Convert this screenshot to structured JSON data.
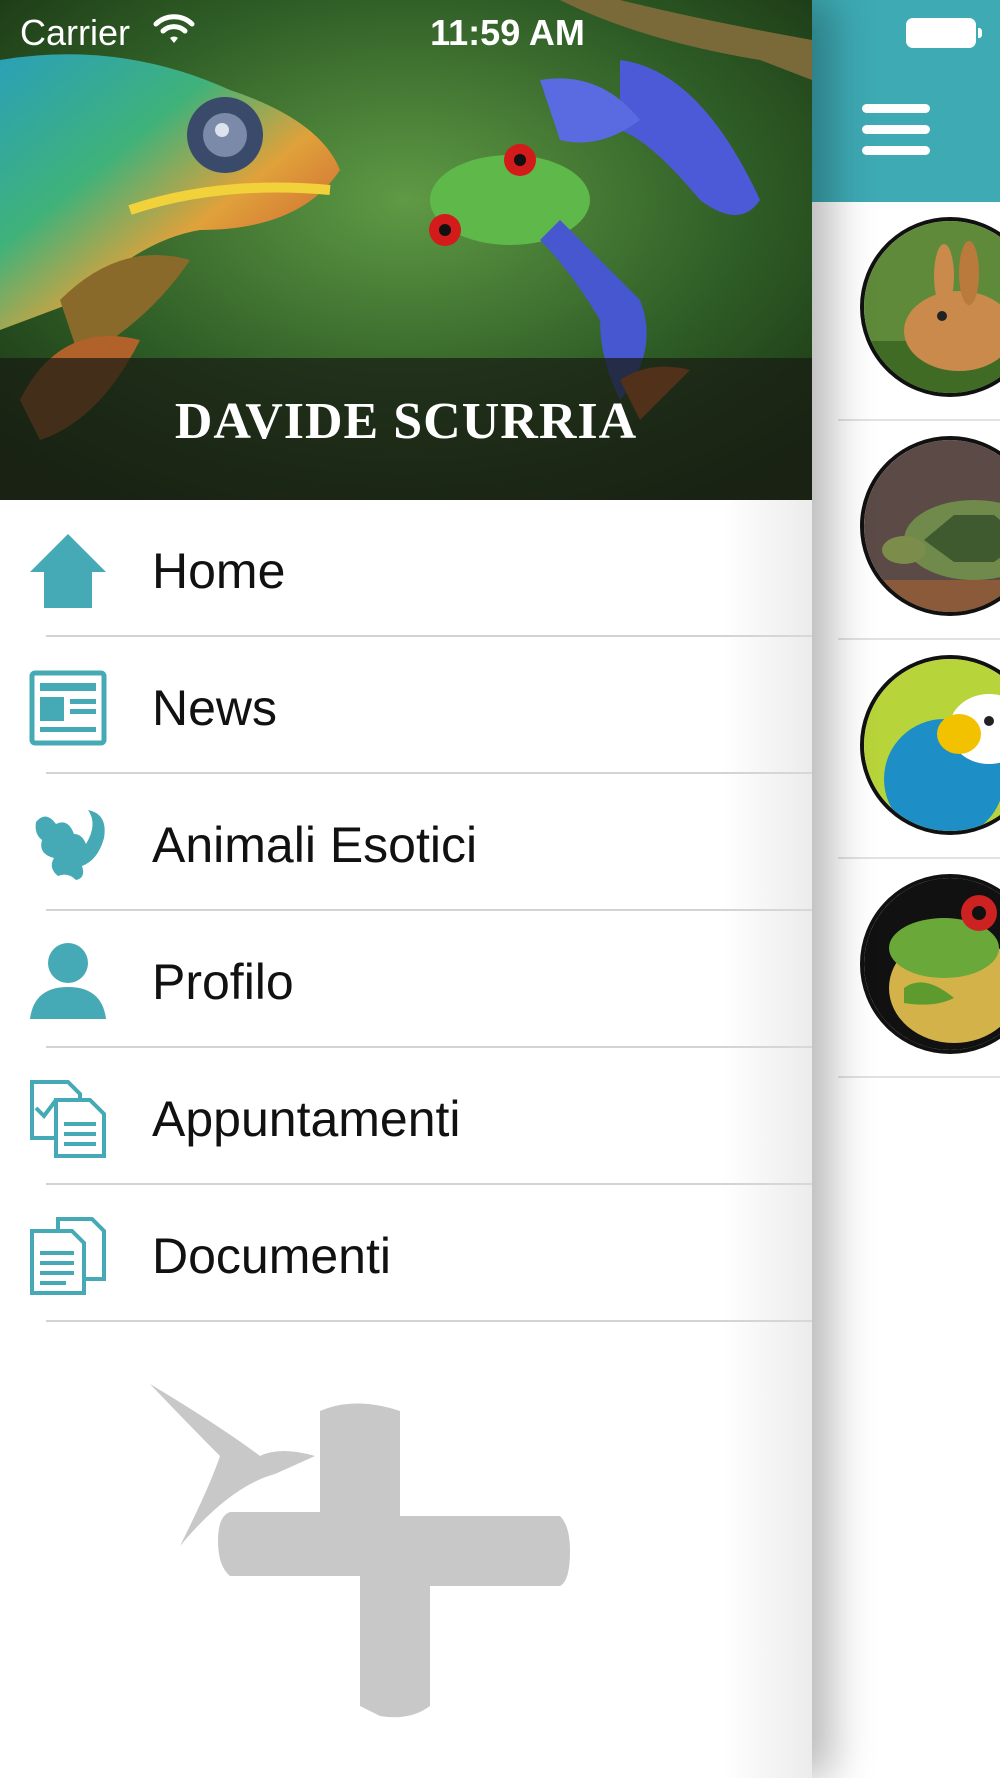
{
  "status_bar": {
    "carrier": "Carrier",
    "time": "11:59 AM"
  },
  "drawer": {
    "header_name": "DAVIDE SCURRIA",
    "items": [
      {
        "label": "Home",
        "icon": "home-icon"
      },
      {
        "label": "News",
        "icon": "newspaper-icon"
      },
      {
        "label": "Animali Esotici",
        "icon": "squirrel-icon"
      },
      {
        "label": "Profilo",
        "icon": "user-icon"
      },
      {
        "label": "Appuntamenti",
        "icon": "checklist-icon"
      },
      {
        "label": "Documenti",
        "icon": "documents-icon"
      }
    ]
  },
  "main": {
    "menu_icon": "hamburger-icon",
    "animals": [
      {
        "icon": "rabbit-thumbnail"
      },
      {
        "icon": "turtle-thumbnail"
      },
      {
        "icon": "parrot-thumbnail"
      },
      {
        "icon": "frog-thumbnail"
      }
    ]
  },
  "colors": {
    "accent": "#3eaab4",
    "icon_teal": "#45aab5",
    "separator": "#d3d3d3",
    "logo_gray": "#c8c8c8"
  }
}
